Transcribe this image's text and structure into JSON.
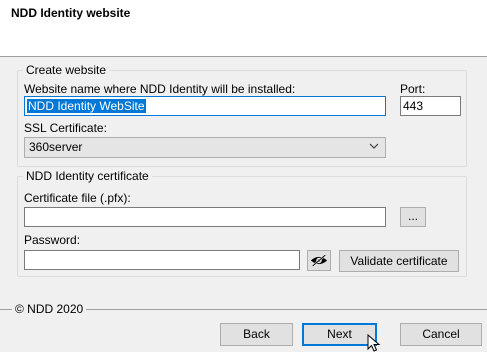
{
  "header": {
    "title": "NDD Identity website"
  },
  "website_group": {
    "legend": "Create website",
    "name_label": "Website name where NDD Identity will be installed:",
    "name_value": "NDD Identity WebSite",
    "port_label": "Port:",
    "port_value": "443",
    "ssl_label": "SSL Certificate:",
    "ssl_value": "360server"
  },
  "cert_group": {
    "legend": "NDD Identity certificate",
    "file_label": "Certificate file (.pfx):",
    "file_value": "",
    "browse_label": "...",
    "password_label": "Password:",
    "password_value": "",
    "validate_label": "Validate certificate"
  },
  "footer": {
    "copyright": "© NDD 2020",
    "back_label": "Back",
    "next_label": "Next",
    "cancel_label": "Cancel"
  },
  "icons": {
    "dropdown": "chevron-down-icon",
    "password_toggle": "eye-slash-icon",
    "cursor": "mouse-pointer-icon"
  },
  "colors": {
    "accent": "#0078d7",
    "window_bg": "#f0f0f0",
    "header_bg": "#ffffff"
  }
}
